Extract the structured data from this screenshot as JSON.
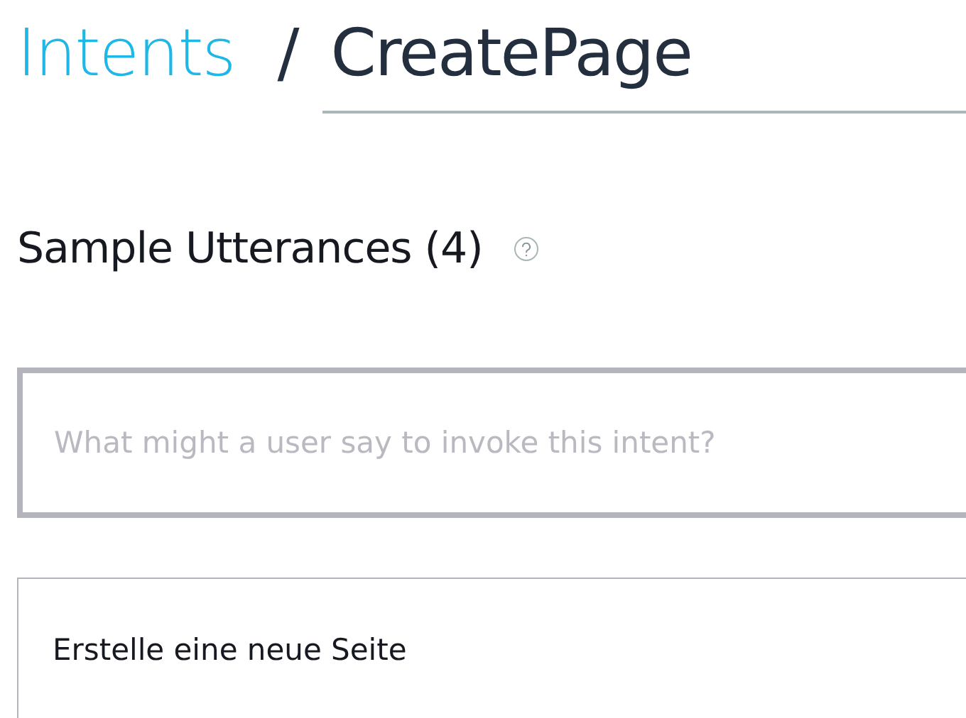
{
  "breadcrumb": {
    "parent": "Intents",
    "separator": "/",
    "title": "CreatePage"
  },
  "section": {
    "title": "Sample Utterances (4)"
  },
  "utterance_input": {
    "placeholder": "What might a user say to invoke this intent?"
  },
  "utterances": [
    "Erstelle eine neue Seite"
  ]
}
